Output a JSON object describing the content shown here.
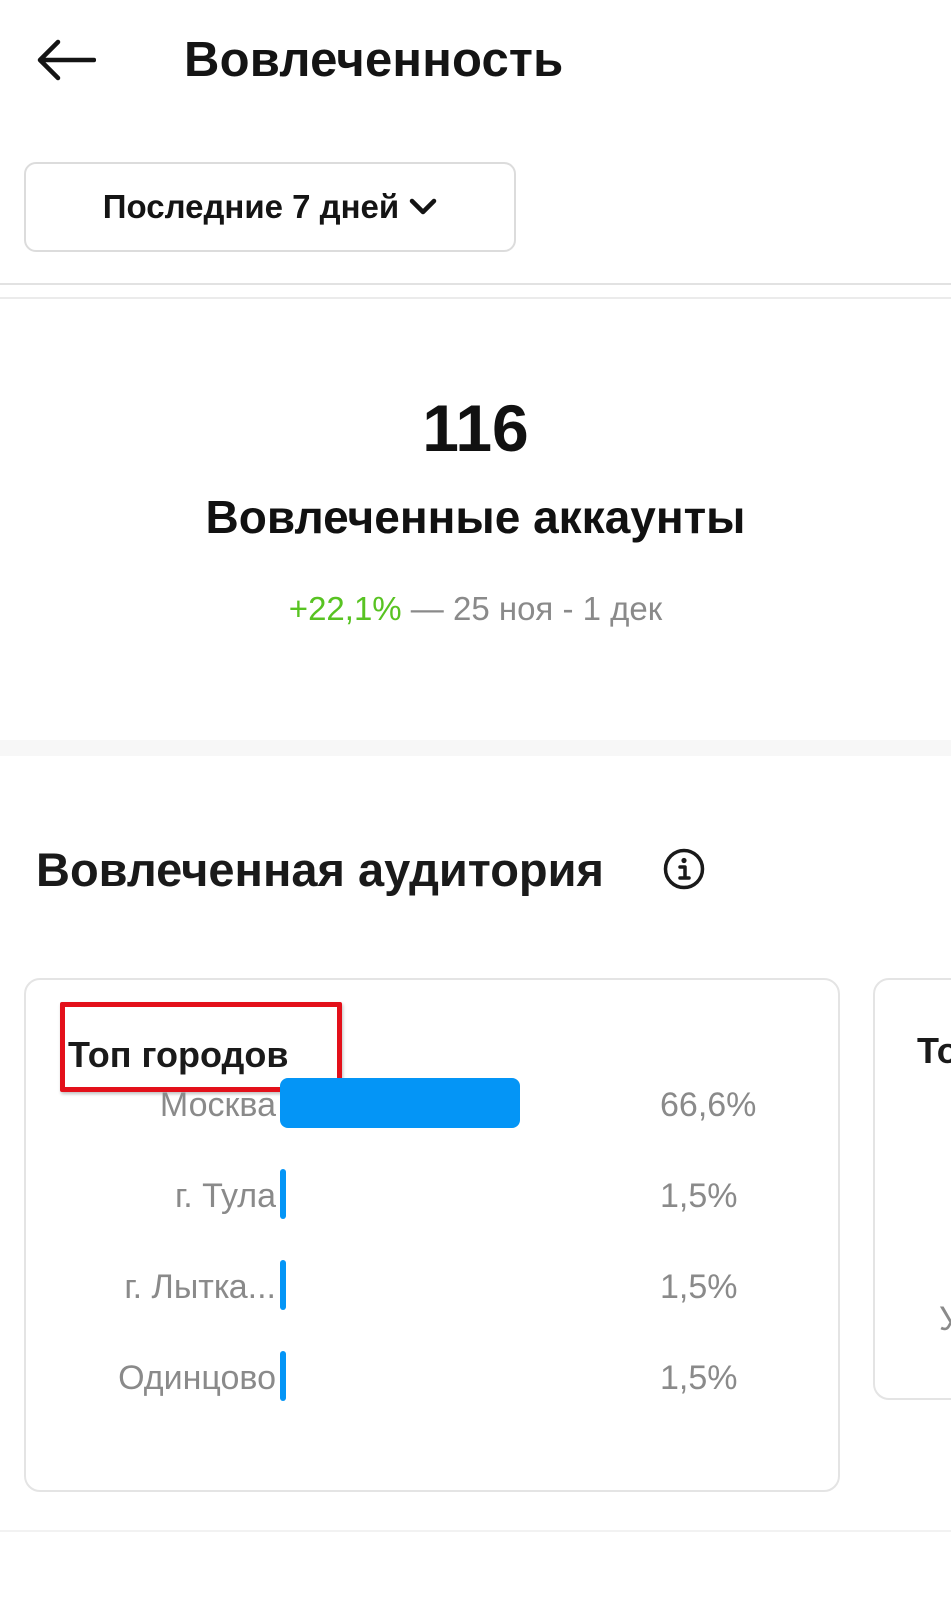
{
  "header": {
    "title": "Вовлеченность",
    "back_icon": "arrow-left-icon"
  },
  "range": {
    "label": "Последние 7 дней",
    "icon": "chevron-down-icon"
  },
  "summary": {
    "value": "116",
    "label": "Вовлеченные аккаунты",
    "delta": "+22,1%",
    "period": " — 25 ноя - 1 дек",
    "delta_color": "#58c322"
  },
  "audience": {
    "title": "Вовлеченная аудитория",
    "info_icon": "info-icon",
    "top_cities": {
      "title": "Топ городов",
      "bar_color": "#0495f6",
      "rows": [
        {
          "city": "Москва",
          "percent": "66,6%",
          "value": 66.6
        },
        {
          "city": "г. Тула",
          "percent": "1,5%",
          "value": 1.5
        },
        {
          "city": "г. Лыткa...",
          "percent": "1,5%",
          "value": 1.5
        },
        {
          "city": "Одинцово",
          "percent": "1,5%",
          "value": 1.5
        }
      ]
    },
    "next_card": {
      "title_fragment": "То",
      "text_fragment": "У"
    }
  }
}
